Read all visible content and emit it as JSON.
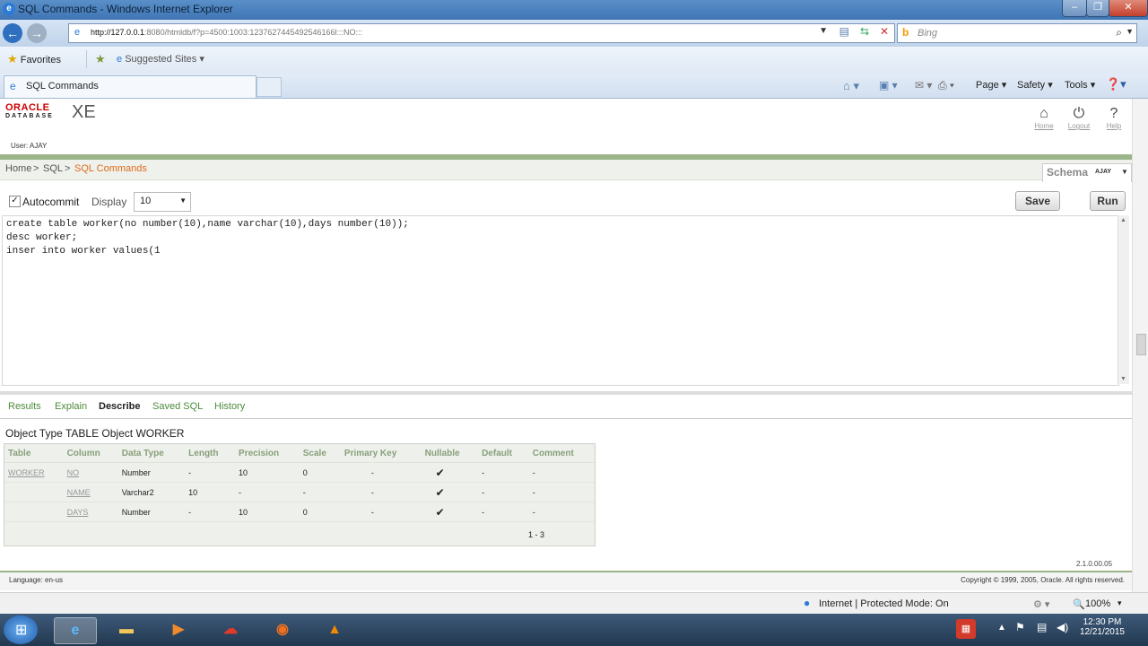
{
  "browser": {
    "window_title": "SQL Commands - Windows Internet Explorer",
    "url_host": "http://127.0.0.1",
    "url_rest": ":8080/htmldb/f?p=4500:1003:1237627445492546166l:::NO:::",
    "search_placeholder": "Bing",
    "favorites_label": "Favorites",
    "suggested_sites_label": "Suggested Sites",
    "tab_title": "SQL Commands",
    "cmd_page": "Page",
    "cmd_safety": "Safety",
    "cmd_tools": "Tools"
  },
  "oracle": {
    "logo_top": "ORACLE",
    "logo_bottom": "DATABASE",
    "edition": "XE",
    "user_line": "User: AJAY",
    "nav_home": "Home",
    "nav_logout": "Logout",
    "nav_help": "Help"
  },
  "breadcrumb": {
    "home": "Home",
    "sep1": ">",
    "sql": "SQL",
    "sep2": ">",
    "current": "SQL Commands",
    "schema_label": "Schema",
    "schema_value": "AJAY"
  },
  "toolbar": {
    "autocommit_label": "Autocommit",
    "autocommit_checked": true,
    "display_label": "Display",
    "display_value": "10",
    "save_label": "Save",
    "run_label": "Run"
  },
  "editor": {
    "lines": [
      "create table worker(no number(10),name varchar(10),days number(10));",
      "desc worker;",
      "inser into worker values(1"
    ]
  },
  "result_tabs": [
    "Results",
    "Explain",
    "Describe",
    "Saved SQL",
    "History"
  ],
  "active_result_tab": "Describe",
  "describe": {
    "object_type_label": "Object Type",
    "object_type_value": "TABLE",
    "object_label": "Object",
    "object_value": "WORKER",
    "headers": [
      "Table",
      "Column",
      "Data Type",
      "Length",
      "Precision",
      "Scale",
      "Primary Key",
      "Nullable",
      "Default",
      "Comment"
    ],
    "rows": [
      [
        "WORKER",
        "NO",
        "Number",
        "-",
        "10",
        "0",
        "-",
        "✔",
        "-",
        "-"
      ],
      [
        "",
        "NAME",
        "Varchar2",
        "10",
        "-",
        "-",
        "-",
        "✔",
        "-",
        "-"
      ],
      [
        "",
        "DAYS",
        "Number",
        "-",
        "10",
        "0",
        "-",
        "✔",
        "-",
        "-"
      ]
    ],
    "pagination": "1 - 3"
  },
  "footer": {
    "version": "2.1.0.00.05",
    "language": "Language: en-us",
    "copyright": "Copyright © 1999, 2005, Oracle. All rights reserved."
  },
  "statusbar": {
    "zone": "Internet | Protected Mode: On",
    "zoom": "100%"
  },
  "taskbar": {
    "time": "12:30 PM",
    "date": "12/21/2015"
  }
}
